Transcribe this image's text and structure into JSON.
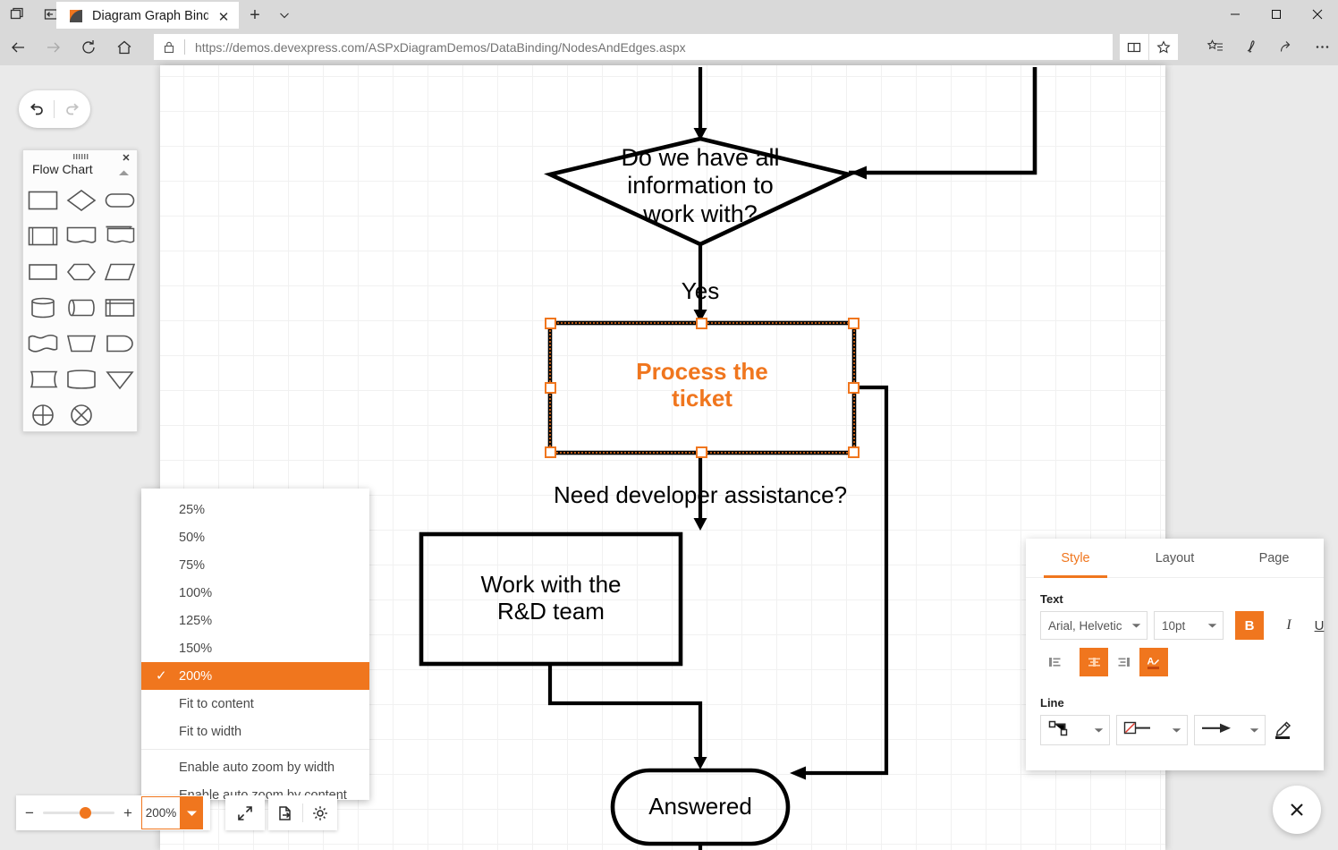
{
  "browser": {
    "tab_title": "Diagram Graph Binding",
    "url_scheme": "https://",
    "url_host": "demos.devexpress.com",
    "url_path": "/ASPxDiagramDemos/DataBinding/NodesAndEdges.aspx",
    "url_full": "https://demos.devexpress.com/ASPxDiagramDemos/DataBinding/NodesAndEdges.aspx",
    "icons": {
      "window_list": "window-list-icon",
      "set_aside": "set-aside-tabs-icon",
      "new_tab": "+",
      "tab_menu": "chevron-down-icon",
      "minimize": "minimize-icon",
      "maximize": "maximize-icon",
      "close": "close-icon",
      "back": "back-arrow-icon",
      "forward": "forward-arrow-icon",
      "refresh": "refresh-icon",
      "home": "home-icon",
      "lock": "lock-icon",
      "reading_view": "reading-view-icon",
      "favorite": "star-icon",
      "favorites_hub": "favorites-hub-icon",
      "web_note": "web-note-pen-icon",
      "share": "share-icon",
      "more": "more-dots-icon"
    }
  },
  "toolbar": {
    "undo": "undo-icon",
    "redo": "redo-icon"
  },
  "palette": {
    "title": "Flow Chart",
    "close": "close-icon",
    "collapse": "collapse-chevron-icon",
    "grip": "drag-grip-icon",
    "shapes": [
      "process-rectangle",
      "decision-diamond",
      "terminator-rounded",
      "predefined-process",
      "document",
      "multiple-documents",
      "rectangle-plain",
      "preparation-hexagon",
      "data-parallelogram",
      "database-cylinder",
      "direct-data",
      "internal-storage",
      "wave-document",
      "manual-operation",
      "display",
      "card",
      "delay",
      "merge-triangle",
      "summing-junction",
      "or-junction"
    ]
  },
  "diagram": {
    "nodes": [
      {
        "id": "decision",
        "type": "diamond",
        "text": "Do we have all\ninformation to\nwork with?",
        "selected": false
      },
      {
        "id": "process",
        "type": "rectangle",
        "text": "Process the\nticket",
        "selected": true
      },
      {
        "id": "rnd",
        "type": "rectangle",
        "text": "Work with the\nR&D team",
        "selected": false
      },
      {
        "id": "answered",
        "type": "terminator",
        "text": "Answered",
        "selected": false
      }
    ],
    "edge_labels": [
      "Yes",
      "Need developer assistance?"
    ],
    "selection_handle_count": 8
  },
  "zoom_menu": {
    "items": [
      {
        "label": "25%",
        "selected": false
      },
      {
        "label": "50%",
        "selected": false
      },
      {
        "label": "75%",
        "selected": false
      },
      {
        "label": "100%",
        "selected": false
      },
      {
        "label": "125%",
        "selected": false
      },
      {
        "label": "150%",
        "selected": false
      },
      {
        "label": "200%",
        "selected": true
      },
      {
        "label": "Fit to content",
        "selected": false
      },
      {
        "label": "Fit to width",
        "selected": false
      },
      {
        "label": "Enable auto zoom by width",
        "selected": false
      },
      {
        "label": "Enable auto zoom by content",
        "selected": false
      }
    ],
    "check_glyph": "✓"
  },
  "bottom_toolbar": {
    "zoom_out": "−",
    "zoom_in": "+",
    "zoom_value": "200%",
    "zoom_dropdown": "dropdown-arrow-icon",
    "fullscreen": "fullscreen-icon",
    "export": "export-icon",
    "settings": "gear-icon"
  },
  "properties": {
    "tabs": [
      {
        "label": "Style",
        "active": true
      },
      {
        "label": "Layout",
        "active": false
      },
      {
        "label": "Page",
        "active": false
      }
    ],
    "text_section": {
      "heading": "Text",
      "font_family": "Arial, Helvetic",
      "font_size": "10pt",
      "bold": {
        "label": "B",
        "active": true
      },
      "italic": {
        "label": "I",
        "active": false
      },
      "underline": {
        "label": "U",
        "active": false
      },
      "align_left": {
        "name": "align-left-icon",
        "active": false
      },
      "align_center": {
        "name": "align-center-icon",
        "active": true
      },
      "align_right": {
        "name": "align-right-icon",
        "active": false
      },
      "font_color": {
        "name": "font-color-icon",
        "active": true
      }
    },
    "line_section": {
      "heading": "Line",
      "route": "orthogonal-route-icon",
      "start_cap": "no-arrow-start-icon",
      "end_cap": "arrow-end-icon",
      "line_color": "line-color-pen-icon"
    }
  },
  "overlay": {
    "close_button": "close-icon"
  },
  "colors": {
    "accent": "#f0761e",
    "chrome": "#d9d9d9",
    "canvas_bg": "#eaeaea",
    "grid_line": "#f1f1f1",
    "shape_stroke": "#000000"
  }
}
